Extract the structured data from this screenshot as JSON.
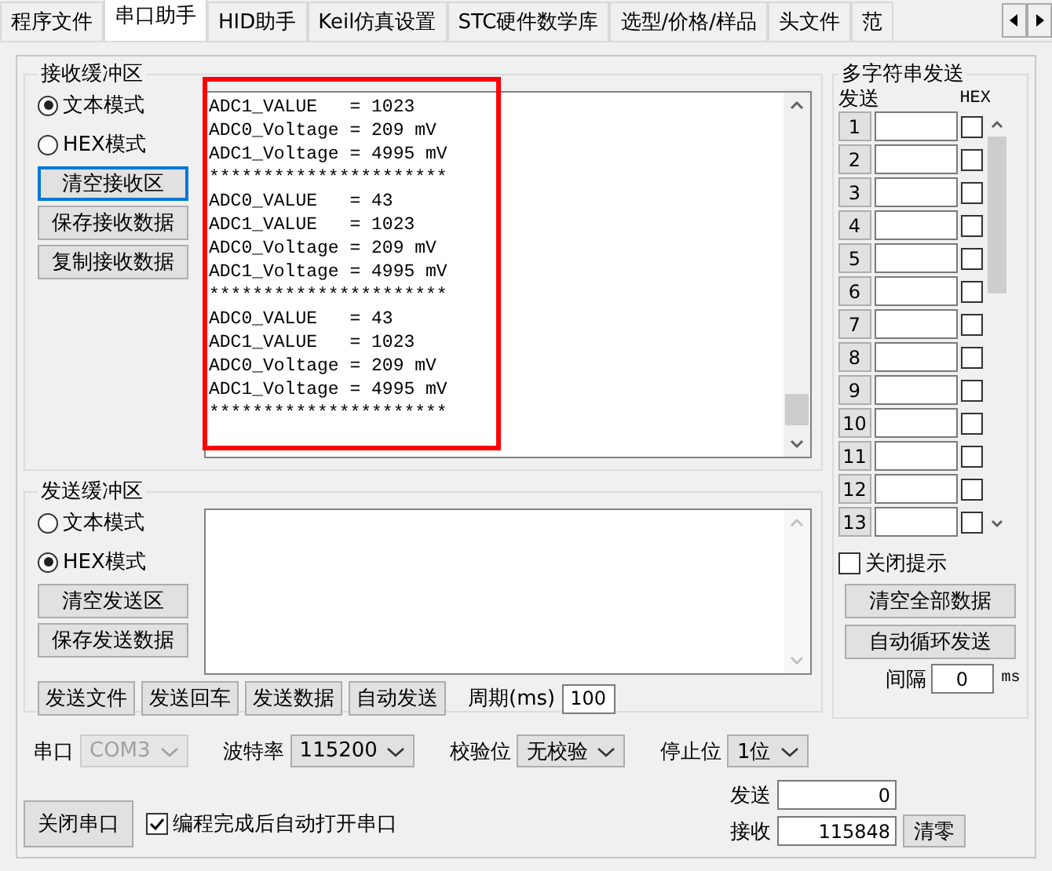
{
  "tabs": [
    {
      "label": "程序文件",
      "selected": false
    },
    {
      "label": "串口助手",
      "selected": true
    },
    {
      "label": "HID助手",
      "selected": false
    },
    {
      "label": "Keil仿真设置",
      "selected": false
    },
    {
      "label": "STC硬件数学库",
      "selected": false
    },
    {
      "label": "选型/价格/样品",
      "selected": false
    },
    {
      "label": "头文件",
      "selected": false
    },
    {
      "label": "范",
      "selected": false
    }
  ],
  "receive": {
    "title": "接收缓冲区",
    "modes": [
      {
        "label": "文本模式",
        "selected": true
      },
      {
        "label": "HEX模式",
        "selected": false
      }
    ],
    "buttons": [
      {
        "label": "清空接收区",
        "focused": true
      },
      {
        "label": "保存接收数据",
        "focused": false
      },
      {
        "label": "复制接收数据",
        "focused": false
      }
    ],
    "lines": [
      "ADC1_VALUE   = 1023",
      "ADC0_Voltage = 209 mV",
      "ADC1_Voltage = 4995 mV",
      "**********************",
      "ADC0_VALUE   = 43",
      "ADC1_VALUE   = 1023",
      "ADC0_Voltage = 209 mV",
      "ADC1_Voltage = 4995 mV",
      "**********************",
      "ADC0_VALUE   = 43",
      "ADC1_VALUE   = 1023",
      "ADC0_Voltage = 209 mV",
      "ADC1_Voltage = 4995 mV",
      "**********************"
    ]
  },
  "send": {
    "title": "发送缓冲区",
    "modes": [
      {
        "label": "文本模式",
        "selected": false
      },
      {
        "label": "HEX模式",
        "selected": true
      }
    ],
    "buttons": [
      "清空发送区",
      "保存发送数据"
    ],
    "actions": [
      "发送文件",
      "发送回车",
      "发送数据",
      "自动发送"
    ],
    "period_label": "周期(ms)",
    "period": "100"
  },
  "multi": {
    "title": "多字符串发送",
    "send_header": "发送",
    "hex_header": "HEX",
    "rows": [
      {
        "label": "1",
        "hex": false
      },
      {
        "label": "2",
        "hex": false
      },
      {
        "label": "3",
        "hex": false
      },
      {
        "label": "4",
        "hex": false
      },
      {
        "label": "5",
        "hex": false
      },
      {
        "label": "6",
        "hex": false
      },
      {
        "label": "7",
        "hex": false
      },
      {
        "label": "8",
        "hex": false
      },
      {
        "label": "9",
        "hex": false
      },
      {
        "label": "10",
        "hex": false
      },
      {
        "label": "11",
        "hex": false
      },
      {
        "label": "12",
        "hex": false
      },
      {
        "label": "13",
        "hex": false
      }
    ],
    "close_hint": {
      "label": "关闭提示",
      "checked": false
    },
    "buttons": [
      "清空全部数据",
      "自动循环发送"
    ],
    "interval_label": "间隔",
    "interval": "0",
    "interval_unit": "ms"
  },
  "settings": [
    {
      "label": "串口",
      "value": "COM3",
      "disabled": true
    },
    {
      "label": "波特率",
      "value": "115200",
      "disabled": false
    },
    {
      "label": "校验位",
      "value": "无校验",
      "disabled": false
    },
    {
      "label": "停止位",
      "value": "1位",
      "disabled": false
    }
  ],
  "close_port": "关闭串口",
  "auto_open": {
    "label": "编程完成后自动打开串口",
    "checked": true
  },
  "counters": [
    {
      "label": "发送",
      "value": "0"
    },
    {
      "label": "接收",
      "value": "115848"
    }
  ],
  "clear_counts": "清零"
}
